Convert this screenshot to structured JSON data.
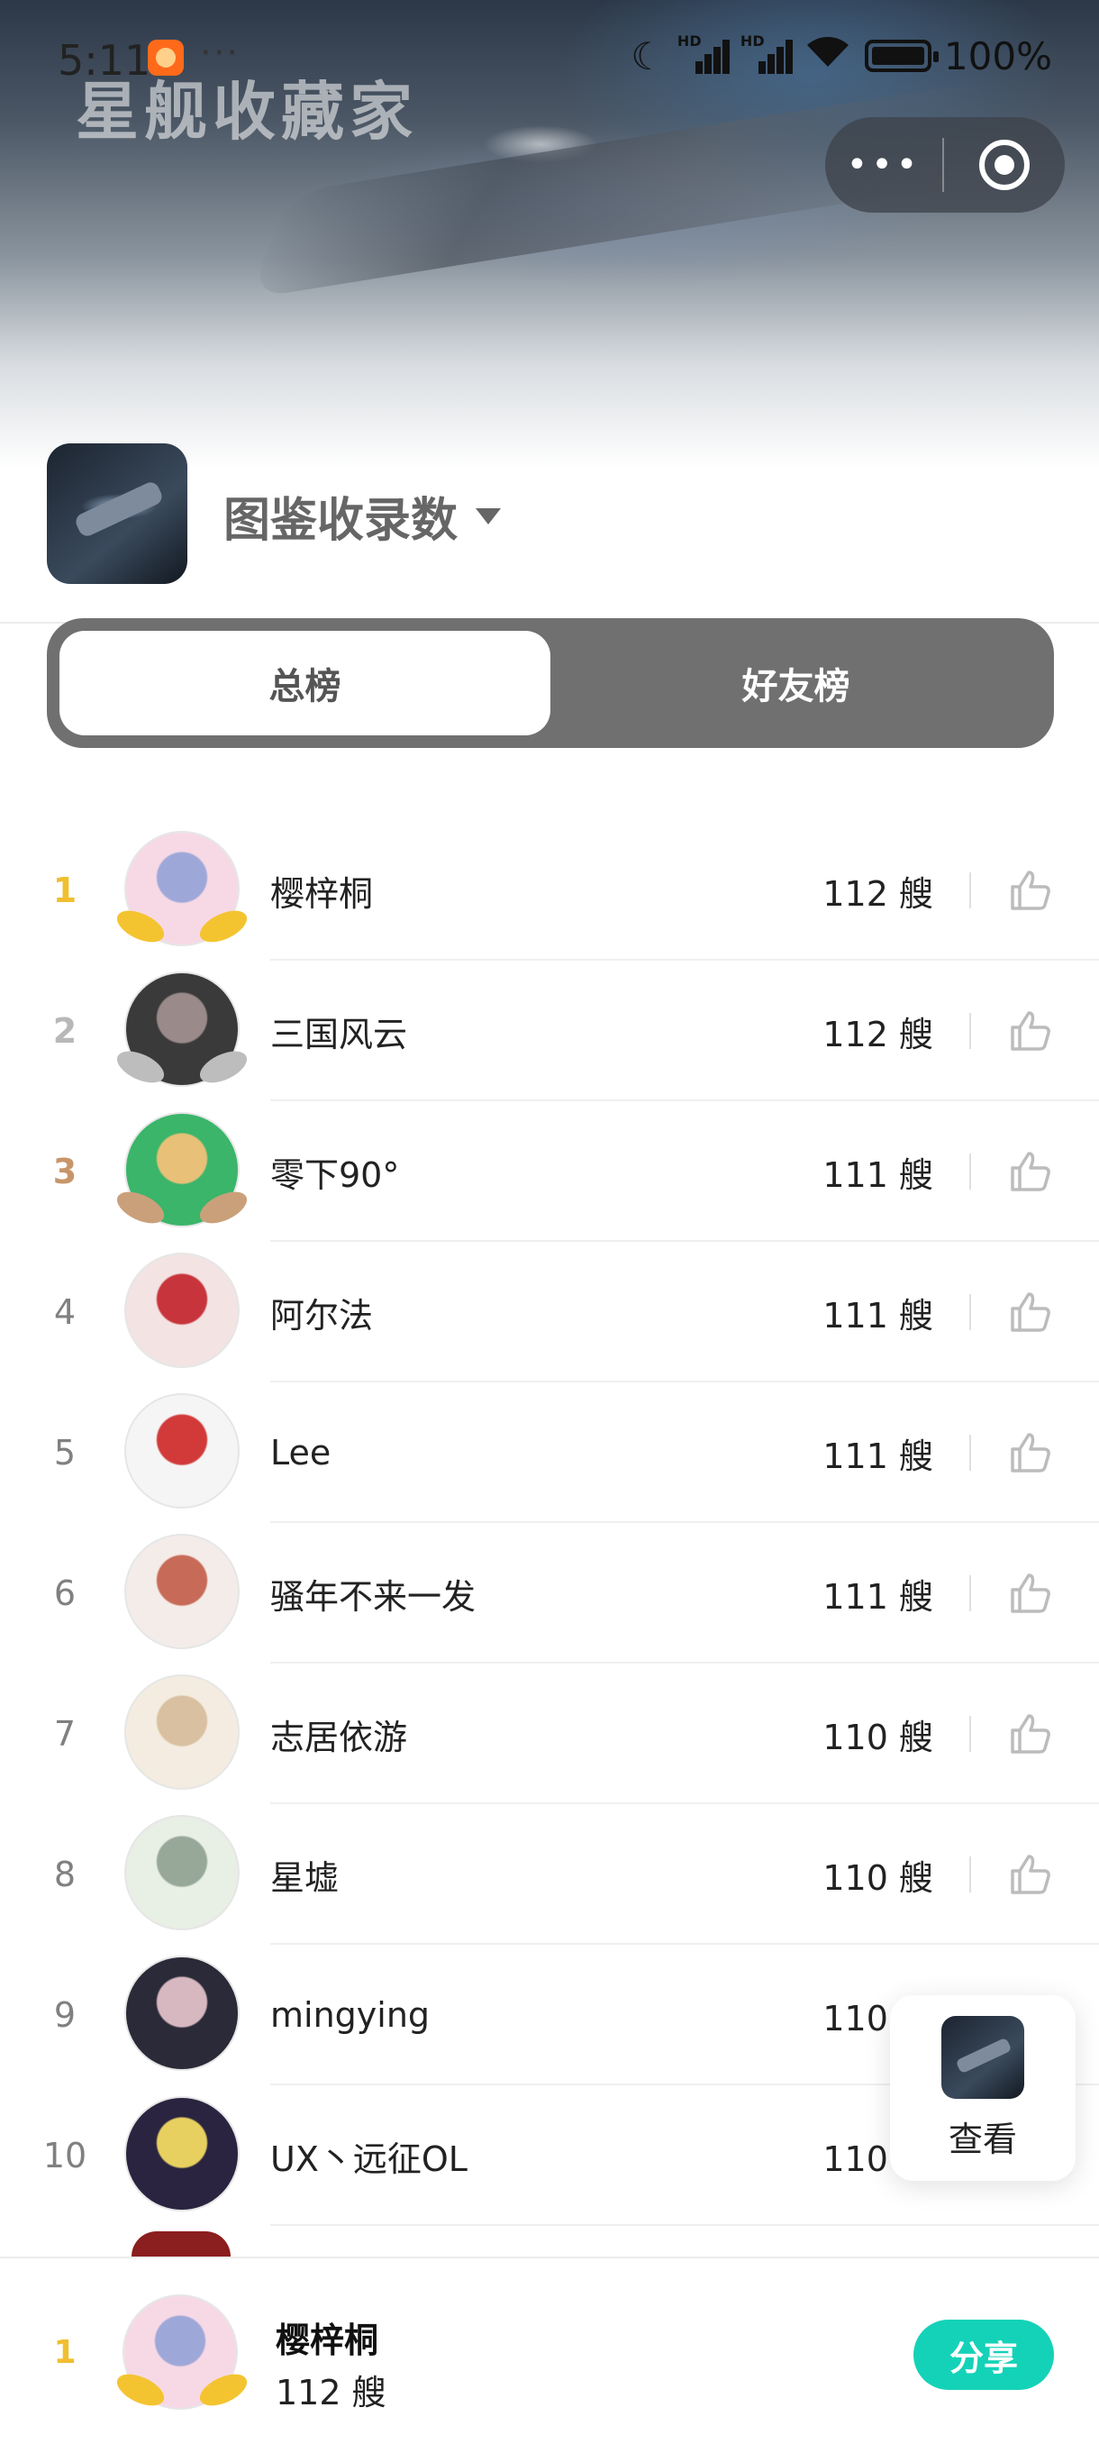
{
  "status_bar": {
    "time": "5:11",
    "more": "···",
    "hd1": "HD",
    "hd2": "HD",
    "battery": "100%"
  },
  "app": {
    "title": "星舰收藏家"
  },
  "header": {
    "metric": "图鉴收录数"
  },
  "tabs": [
    {
      "label": "总榜",
      "active": true
    },
    {
      "label": "好友榜",
      "active": false
    }
  ],
  "rows": [
    {
      "rank": "1",
      "name": "樱梓桐",
      "score": "112 艘",
      "medal": "gold",
      "avatar": [
        "#f7d9e6",
        "#9ea8d8"
      ]
    },
    {
      "rank": "2",
      "name": "三国风云",
      "score": "112 艘",
      "medal": "silver",
      "avatar": [
        "#3a3a3a",
        "#9a8a8a"
      ]
    },
    {
      "rank": "3",
      "name": "零下90°",
      "score": "111 艘",
      "medal": "bronze",
      "avatar": [
        "#3ab56a",
        "#e8c078"
      ]
    },
    {
      "rank": "4",
      "name": "阿尔法",
      "score": "111 艘",
      "avatar": [
        "#f3e3e3",
        "#c8343c"
      ]
    },
    {
      "rank": "5",
      "name": "Lee",
      "score": "111 艘",
      "avatar": [
        "#f5f5f5",
        "#d23a3a"
      ]
    },
    {
      "rank": "6",
      "name": "骚年不来一发",
      "score": "111 艘",
      "avatar": [
        "#f4ece8",
        "#c86a58"
      ]
    },
    {
      "rank": "7",
      "name": "志居依游",
      "score": "110 艘",
      "avatar": [
        "#f4ece0",
        "#d8c0a0"
      ]
    },
    {
      "rank": "8",
      "name": "星墟",
      "score": "110 艘",
      "avatar": [
        "#e8efe4",
        "#98a898"
      ]
    },
    {
      "rank": "9",
      "name": "mingying",
      "score": "110 艘",
      "avatar": [
        "#2a2a38",
        "#d8b8c0"
      ]
    },
    {
      "rank": "10",
      "name": "UX丶远征OL",
      "score": "110 艘",
      "avatar": [
        "#2a2440",
        "#e8d060"
      ]
    }
  ],
  "float_card": {
    "label": "查看"
  },
  "me": {
    "rank": "1",
    "name": "樱梓桐",
    "score": "112 艘",
    "avatar": [
      "#f7d9e6",
      "#9ea8d8"
    ]
  },
  "share_label": "分享",
  "colors": {
    "accent": "#14d2b8",
    "gold": "#f0bf30",
    "silver": "#b8b8b8",
    "bronze": "#c8956a",
    "tab_bg": "#707070"
  }
}
